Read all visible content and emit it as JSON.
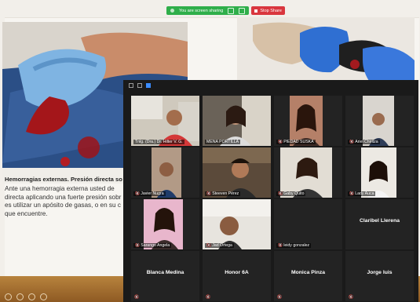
{
  "share_bar": {
    "status": "You are screen sharing",
    "stop_label": "Stop Share"
  },
  "slide": {
    "heading": "Hemorragias externas. Presión directa sobre l",
    "body_lines": [
      "Ante una hemorragia externa usted de",
      "directa aplicando una fuerte presión sobr",
      "es utilizar un apósito de gasas, o en su c",
      "que encuentre."
    ]
  },
  "meeting": {
    "colors": {
      "background": "#1a1a1a",
      "speaker_border": "#9ad43a",
      "muted": "#e2353b"
    },
    "participants": [
      {
        "name": "Tnlg. (Dra.) Dr. Hilter V. G.",
        "video": true,
        "speaker": true,
        "muted": false
      },
      {
        "name": "MENA PORTILLA",
        "video": true,
        "speaker": false,
        "muted": false
      },
      {
        "name": "PIEDAD SUSKA",
        "video": true,
        "speaker": false,
        "muted": true
      },
      {
        "name": "Ariel Chiritza",
        "video": true,
        "speaker": false,
        "muted": true
      },
      {
        "name": "Javier Nugra",
        "video": true,
        "speaker": false,
        "muted": true
      },
      {
        "name": "Steeven Pérez",
        "video": true,
        "speaker": false,
        "muted": true
      },
      {
        "name": "Gaby Quito",
        "video": true,
        "speaker": false,
        "muted": true
      },
      {
        "name": "Lady Auca",
        "video": true,
        "speaker": false,
        "muted": true
      },
      {
        "name": "Sarango Angela",
        "video": true,
        "speaker": false,
        "muted": true
      },
      {
        "name": "Jad Ortega",
        "video": true,
        "speaker": false,
        "muted": true
      },
      {
        "name": "leidy gonzalez",
        "video": false,
        "speaker": false,
        "muted": true
      },
      {
        "name": "Claribel Llerena",
        "video": false,
        "speaker": false,
        "muted": false
      },
      {
        "name": "Blanca Medina",
        "video": false,
        "speaker": false,
        "muted": true
      },
      {
        "name": "Honor 6A",
        "video": false,
        "speaker": false,
        "muted": true
      },
      {
        "name": "Monica Pinza",
        "video": false,
        "speaker": false,
        "muted": true
      },
      {
        "name": "Jorge luis",
        "video": false,
        "speaker": false,
        "muted": true
      }
    ]
  }
}
